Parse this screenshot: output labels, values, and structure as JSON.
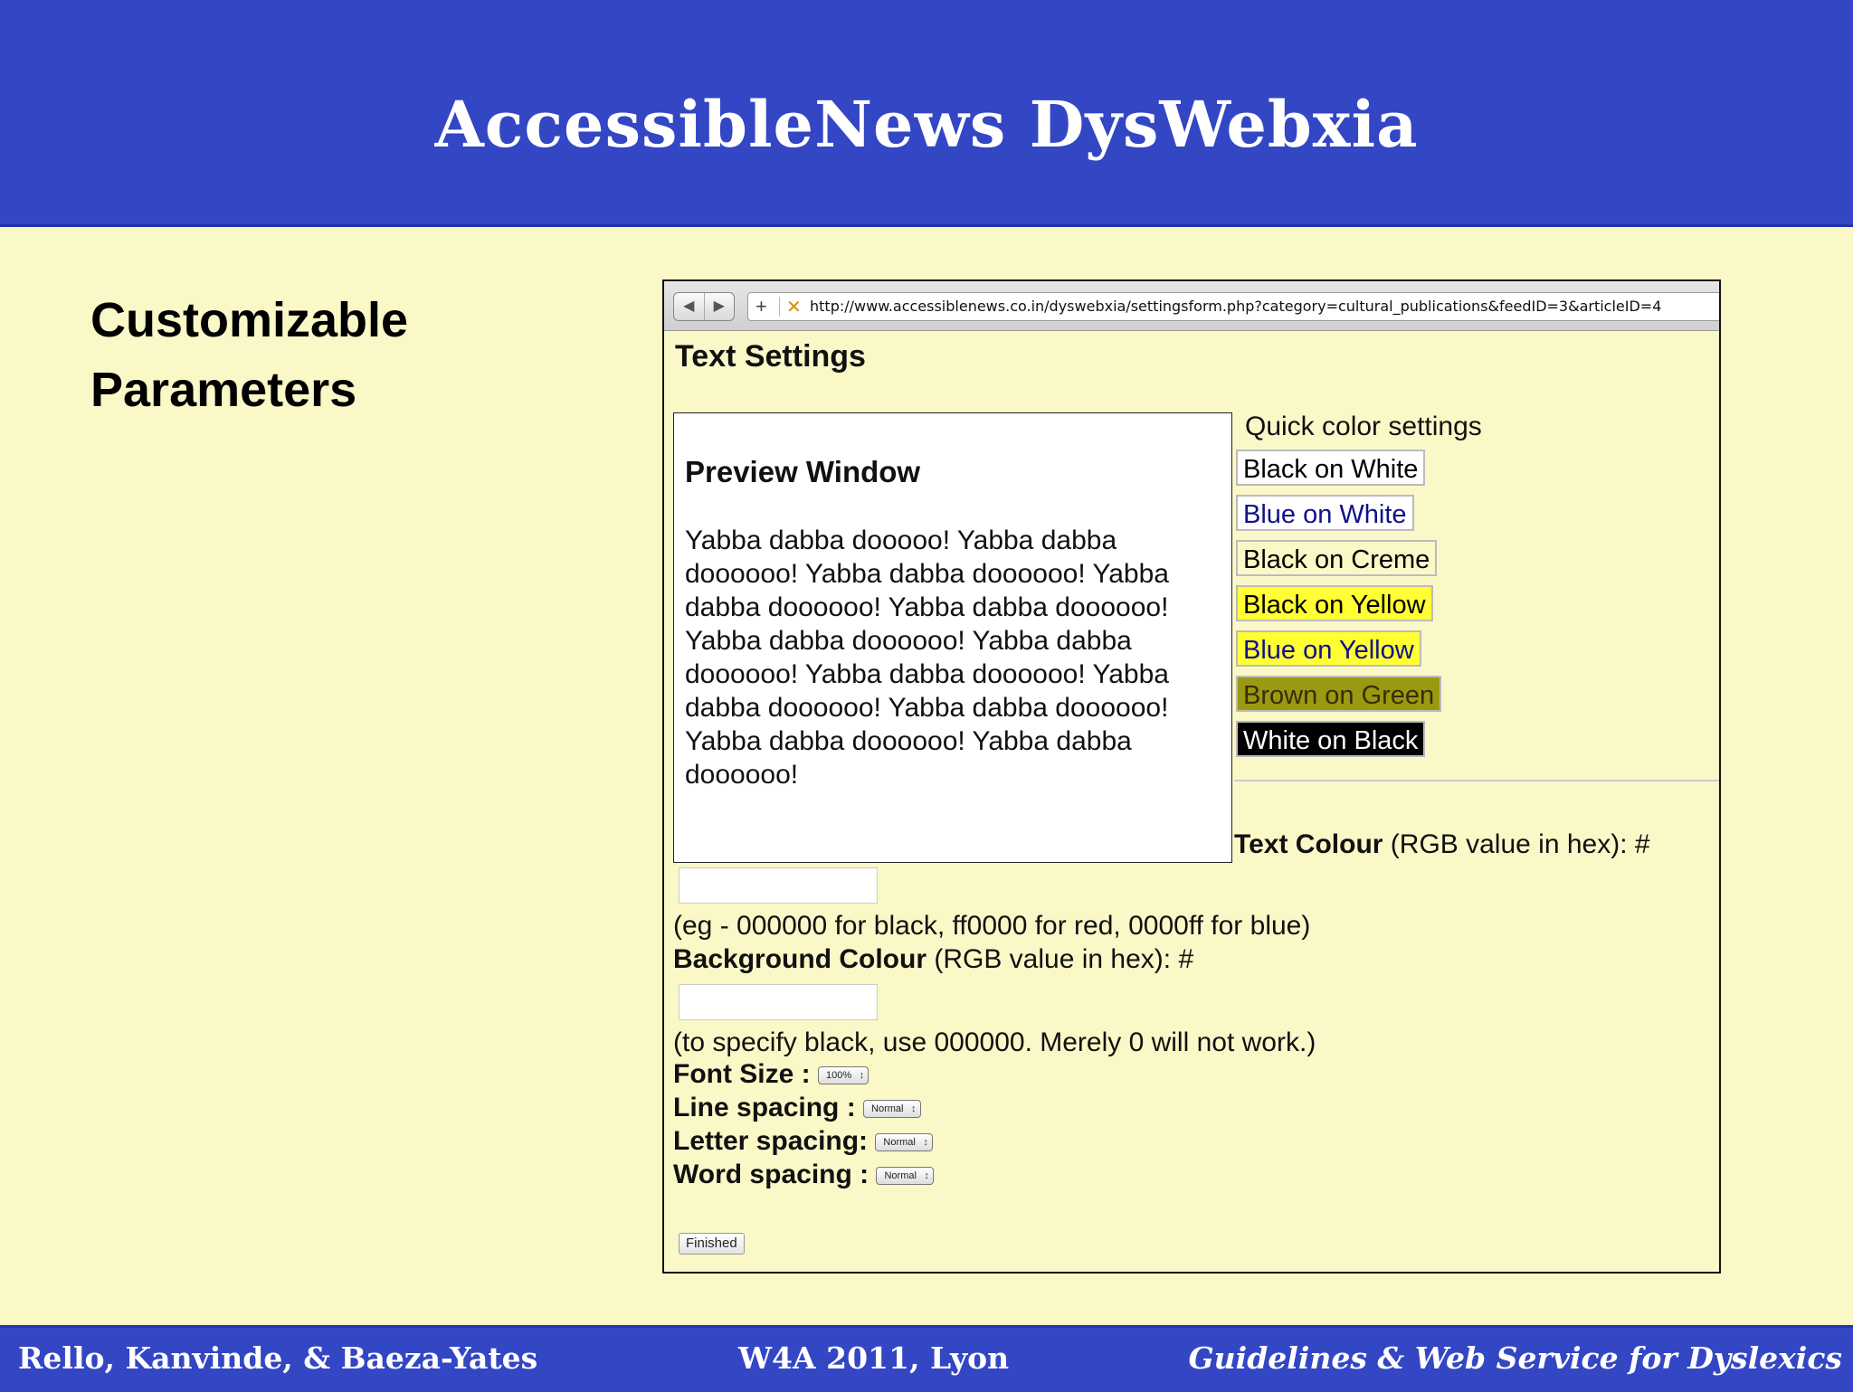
{
  "slide": {
    "title": "AccessibleNews DysWebxia",
    "heading_line1": "Customizable",
    "heading_line2": "Parameters",
    "footer_left": "Rello, Kanvinde, & Baeza-Yates",
    "footer_center": "W4A 2011, Lyon",
    "footer_right": "Guidelines & Web Service for Dyslexics"
  },
  "browser": {
    "url": "http://www.accessiblenews.co.in/dyswebxia/settingsform.php?category=cultural_publications&feedID=3&articleID=4",
    "back_icon": "◀",
    "forward_icon": "▶",
    "plus_icon": "+",
    "favicon": "✕"
  },
  "page": {
    "title": "Text Settings",
    "preview": {
      "title": "Preview Window",
      "text": "Yabba dabba dooooo! Yabba dabba doooooo! Yabba dabba doooooo! Yabba dabba doooooo! Yabba dabba doooooo! Yabba dabba doooooo! Yabba dabba doooooo! Yabba dabba doooooo! Yabba dabba doooooo! Yabba dabba doooooo! Yabba dabba doooooo! Yabba dabba doooooo!"
    },
    "quick_colors": {
      "label": "Quick color settings",
      "options": [
        "Black on White",
        "Blue on White",
        "Black on Creme",
        "Black on Yellow",
        "Blue on Yellow",
        "Brown on Green",
        "White on Black"
      ]
    },
    "text_colour": {
      "label_bold": "Text Colour",
      "label_rest": " (RGB value in hex): #",
      "value": "",
      "hint": "(eg - 000000 for black, ff0000 for red, 0000ff for blue)"
    },
    "background_colour": {
      "label_bold": "Background Colour",
      "label_rest": " (RGB value in hex): #",
      "value": "",
      "hint": "(to specify black, use 000000. Merely 0 will not work.)"
    },
    "font_size": {
      "label": "Font Size :",
      "value": "100%"
    },
    "line_spacing": {
      "label": "Line spacing :",
      "value": "Normal"
    },
    "letter_spacing": {
      "label": "Letter spacing:",
      "value": "Normal"
    },
    "word_spacing": {
      "label": "Word spacing :",
      "value": "Normal"
    },
    "finished_label": "Finished"
  }
}
